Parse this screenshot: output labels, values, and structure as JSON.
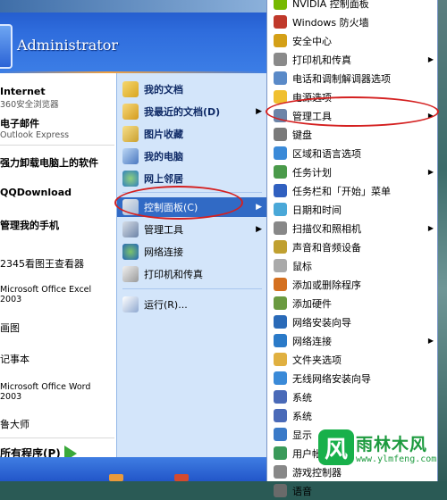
{
  "user": {
    "name": "Administrator"
  },
  "left_pinned": [
    {
      "title": "Internet",
      "subtitle": "360安全浏览器"
    },
    {
      "title": "电子邮件",
      "subtitle": "Outlook Express"
    }
  ],
  "left_recent": [
    "强力卸载电脑上的软件",
    "QQDownload",
    "管理我的手机",
    "2345看图王查看器",
    "Microsoft Office Excel 2003",
    "画图",
    "记事本",
    "Microsoft Office Word 2003",
    "鲁大师"
  ],
  "all_programs": "所有程序(P)",
  "right_items": [
    {
      "label": "我的文档",
      "bold": true,
      "arrow": false
    },
    {
      "label": "我最近的文档(D)",
      "bold": true,
      "arrow": true
    },
    {
      "label": "图片收藏",
      "bold": true,
      "arrow": false
    },
    {
      "label": "我的电脑",
      "bold": true,
      "arrow": false
    },
    {
      "label": "网上邻居",
      "bold": true,
      "arrow": false
    },
    {
      "label": "控制面板(C)",
      "bold": false,
      "arrow": true,
      "highlighted": true
    },
    {
      "label": "管理工具",
      "bold": false,
      "arrow": true
    },
    {
      "label": "网络连接",
      "bold": false,
      "arrow": false
    },
    {
      "label": "打印机和传真",
      "bold": false,
      "arrow": false
    },
    {
      "label": "运行(R)...",
      "bold": false,
      "arrow": false
    }
  ],
  "submenu": [
    {
      "label": "NVIDIA 控制面板",
      "arrow": false
    },
    {
      "label": "Windows 防火墙",
      "arrow": false
    },
    {
      "label": "安全中心",
      "arrow": false
    },
    {
      "label": "打印机和传真",
      "arrow": true
    },
    {
      "label": "电话和调制解调器选项",
      "arrow": false
    },
    {
      "label": "电源选项",
      "arrow": false
    },
    {
      "label": "管理工具",
      "arrow": true
    },
    {
      "label": "键盘",
      "arrow": false
    },
    {
      "label": "区域和语言选项",
      "arrow": false
    },
    {
      "label": "任务计划",
      "arrow": true
    },
    {
      "label": "任务栏和「开始」菜单",
      "arrow": false
    },
    {
      "label": "日期和时间",
      "arrow": false
    },
    {
      "label": "扫描仪和照相机",
      "arrow": true
    },
    {
      "label": "声音和音频设备",
      "arrow": false
    },
    {
      "label": "鼠标",
      "arrow": false
    },
    {
      "label": "添加或删除程序",
      "arrow": false
    },
    {
      "label": "添加硬件",
      "arrow": false
    },
    {
      "label": "网络安装向导",
      "arrow": false
    },
    {
      "label": "网络连接",
      "arrow": true
    },
    {
      "label": "文件夹选项",
      "arrow": false
    },
    {
      "label": "无线网络安装向导",
      "arrow": false
    },
    {
      "label": "系统",
      "arrow": false
    },
    {
      "label": "系统",
      "arrow": false
    },
    {
      "label": "显示",
      "arrow": false
    },
    {
      "label": "用户帐户",
      "arrow": false
    },
    {
      "label": "游戏控制器",
      "arrow": false
    },
    {
      "label": "语音",
      "arrow": false
    }
  ],
  "icon_names": {
    "right": [
      "my-documents-icon",
      "recent-documents-icon",
      "my-pictures-icon",
      "my-computer-icon",
      "network-places-icon",
      "control-panel-icon",
      "admin-tools-icon",
      "network-connections-icon",
      "printers-icon",
      "run-icon"
    ]
  },
  "colors": {
    "highlight": "#316ac5",
    "annotation": "#d42020",
    "right_pane": "#d3e5fa",
    "header": "#2f6ddd"
  },
  "watermark": {
    "logo": "风",
    "name": "雨林木风",
    "url": "www.ylmfeng.com"
  }
}
